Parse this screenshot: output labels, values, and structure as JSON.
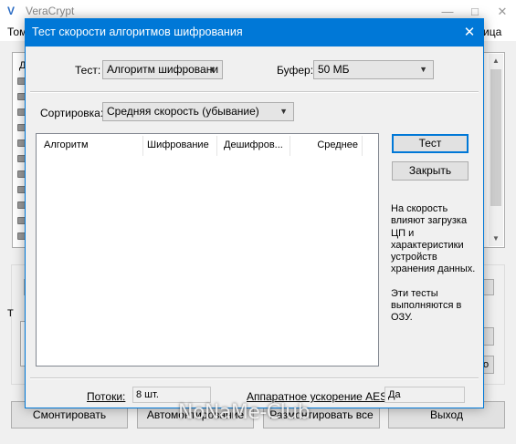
{
  "main": {
    "title": "VeraCrypt",
    "menu_left": "Том",
    "menu_right": "ица",
    "list_header_frag": "Д",
    "group_label_frag": "Т",
    "side_btn_label": "о",
    "buttons": {
      "mount": "Смонтировать",
      "automount": "Автомонтирование",
      "dismount_all": "Размонтировать все",
      "exit": "Выход"
    }
  },
  "dialog": {
    "title": "Тест скорости алгоритмов шифрования",
    "test_label": "Тест:",
    "test_value": "Алгоритм шифровани",
    "buffer_label": "Буфер:",
    "buffer_value": "50 МБ",
    "sort_label": "Сортировка:",
    "sort_value": "Средняя скорость (убывание)",
    "columns": [
      "Алгоритм",
      "Шифрование",
      "Дешифров...",
      "Среднее"
    ],
    "test_button": "Тест",
    "close_button": "Закрыть",
    "info_paragraph_1": "На скорость влияют загрузка ЦП и характеристики устройств хранения данных.",
    "info_paragraph_2": "Эти тесты выполняются в ОЗУ.",
    "threads_label": "Потоки:",
    "threads_value": "8 шт.",
    "aes_label": "Аппаратное ускорение AES:",
    "aes_value": "Да"
  },
  "watermark": "NoNaMe-Club"
}
